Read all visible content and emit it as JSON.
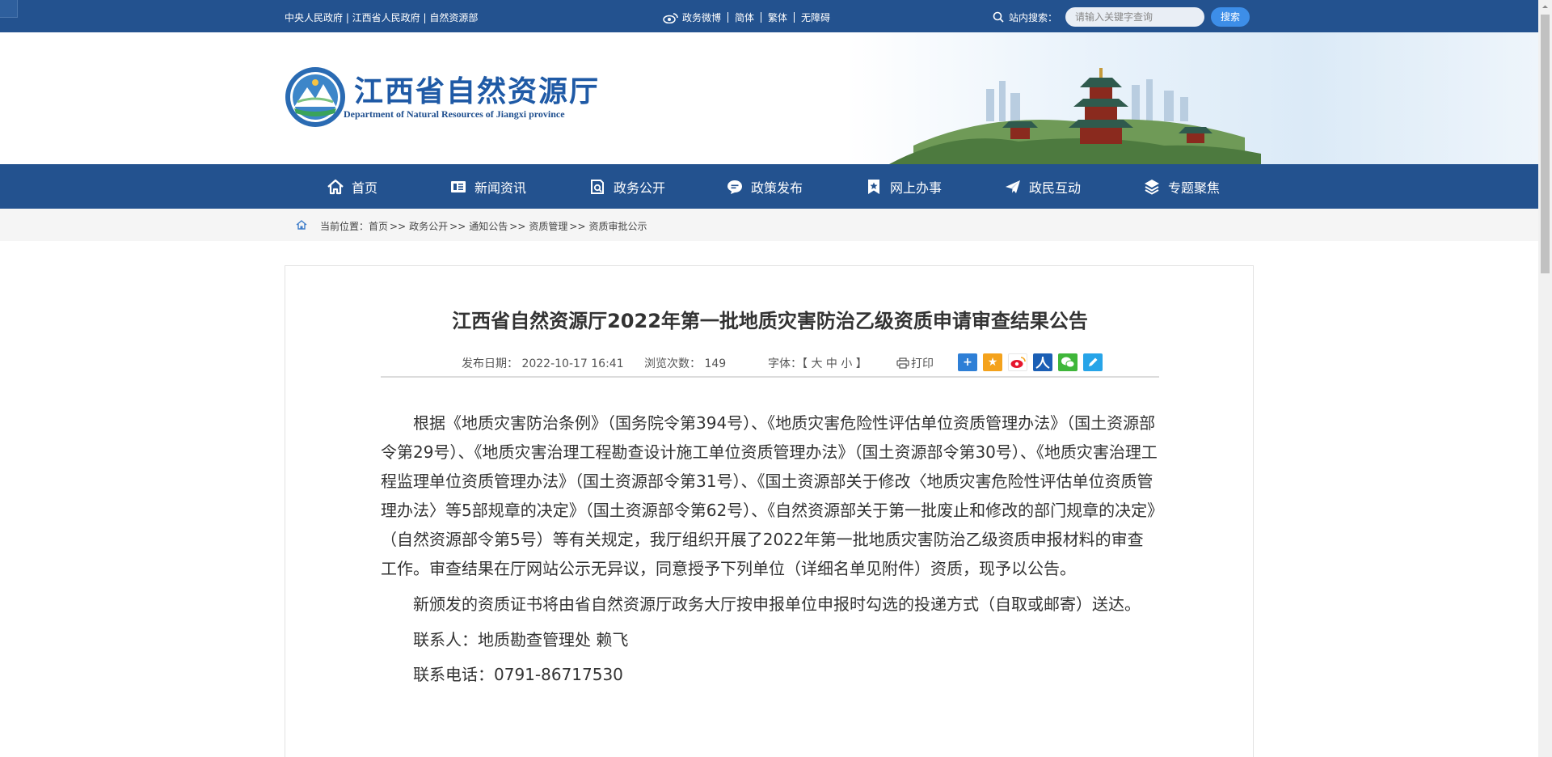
{
  "topbar": {
    "links": "中央人民政府 | 江西省人民政府 | 自然资源部",
    "weibo": "政务微博",
    "simplified": "简体",
    "traditional": "繁体",
    "accessible": "无障碍",
    "search_label": "站内搜索：",
    "search_placeholder": "请输入关键字查询",
    "search_button": "搜索"
  },
  "header": {
    "title": "江西省自然资源厅",
    "subtitle": "Department of Natural Resources of Jiangxi province"
  },
  "nav": {
    "items": [
      {
        "label": "首页",
        "icon": "home-icon"
      },
      {
        "label": "新闻资讯",
        "icon": "newspaper-icon"
      },
      {
        "label": "政务公开",
        "icon": "document-search-icon"
      },
      {
        "label": "政策发布",
        "icon": "chat-icon"
      },
      {
        "label": "网上办事",
        "icon": "bookmark-star-icon"
      },
      {
        "label": "政民互动",
        "icon": "paper-plane-icon"
      },
      {
        "label": "专题聚焦",
        "icon": "layers-icon"
      }
    ]
  },
  "breadcrumb": {
    "prefix": "当前位置：",
    "items": [
      "首页",
      "政务公开",
      "通知公告",
      "资质管理",
      "资质审批公示"
    ],
    "sep": ">>"
  },
  "article": {
    "title": "江西省自然资源厅2022年第一批地质灾害防治乙级资质申请审查结果公告",
    "date_label": "发布日期：  2022-10-17 16:41",
    "views_label": "浏览次数：  149",
    "font_label": "字体：【 大 中 小 】",
    "print_label": "打印",
    "paragraphs": [
      "根据《地质灾害防治条例》（国务院令第394号）、《地质灾害危险性评估单位资质管理办法》（国土资源部令第29号）、《地质灾害治理工程勘查设计施工单位资质管理办法》（国土资源部令第30号）、《地质灾害治理工程监理单位资质管理办法》（国土资源部令第31号）、《国土资源部关于修改〈地质灾害危险性评估单位资质管理办法〉等5部规章的决定》（国土资源部令第62号）、《自然资源部关于第一批废止和修改的部门规章的决定》（自然资源部令第5号）等有关规定，我厅组织开展了2022年第一批地质灾害防治乙级资质申报材料的审查工作。审查结果在厅网站公示无异议，同意授予下列单位（详细名单见附件）资质，现予以公告。",
      "新颁发的资质证书将由省自然资源厅政务大厅按申报单位申报时勾选的投递方式（自取或邮寄）送达。",
      "联系人：地质勘查管理处  赖飞",
      "联系电话：0791-86717530"
    ]
  },
  "colors": {
    "primary": "#23528f",
    "title_blue": "#1f5aa6",
    "search_button": "#3d8ee8"
  }
}
